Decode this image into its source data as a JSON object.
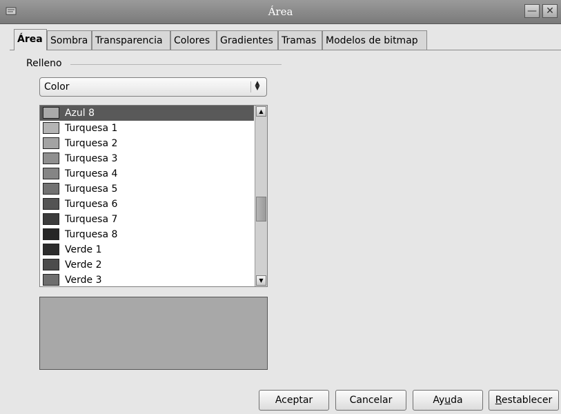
{
  "window": {
    "title": "Área"
  },
  "tabs": [
    {
      "label": "Área",
      "active": true
    },
    {
      "label": "Sombra"
    },
    {
      "label": "Transparencia"
    },
    {
      "label": "Colores"
    },
    {
      "label": "Gradientes"
    },
    {
      "label": "Tramas"
    },
    {
      "label": "Modelos de bitmap"
    }
  ],
  "fill": {
    "group_label": "Relleno",
    "type_select": "Color",
    "colors": [
      {
        "label": "Azul 8",
        "color": "#a9a9a9",
        "selected": true
      },
      {
        "label": "Turquesa 1",
        "color": "#b4b4b4"
      },
      {
        "label": "Turquesa 2",
        "color": "#a3a3a3"
      },
      {
        "label": "Turquesa 3",
        "color": "#8f8f8f"
      },
      {
        "label": "Turquesa 4",
        "color": "#858585"
      },
      {
        "label": "Turquesa 5",
        "color": "#727272"
      },
      {
        "label": "Turquesa 6",
        "color": "#545454"
      },
      {
        "label": "Turquesa 7",
        "color": "#3c3c3c"
      },
      {
        "label": "Turquesa 8",
        "color": "#262626"
      },
      {
        "label": "Verde 1",
        "color": "#2c2c2c"
      },
      {
        "label": "Verde 2",
        "color": "#4c4c4c"
      },
      {
        "label": "Verde 3",
        "color": "#6e6e6e"
      }
    ],
    "preview_color": "#a8a8a8"
  },
  "buttons": {
    "ok": "Aceptar",
    "cancel": "Cancelar",
    "help_pre": "Ay",
    "help_acc": "u",
    "help_post": "da",
    "reset_acc": "R",
    "reset_post": "establecer"
  }
}
